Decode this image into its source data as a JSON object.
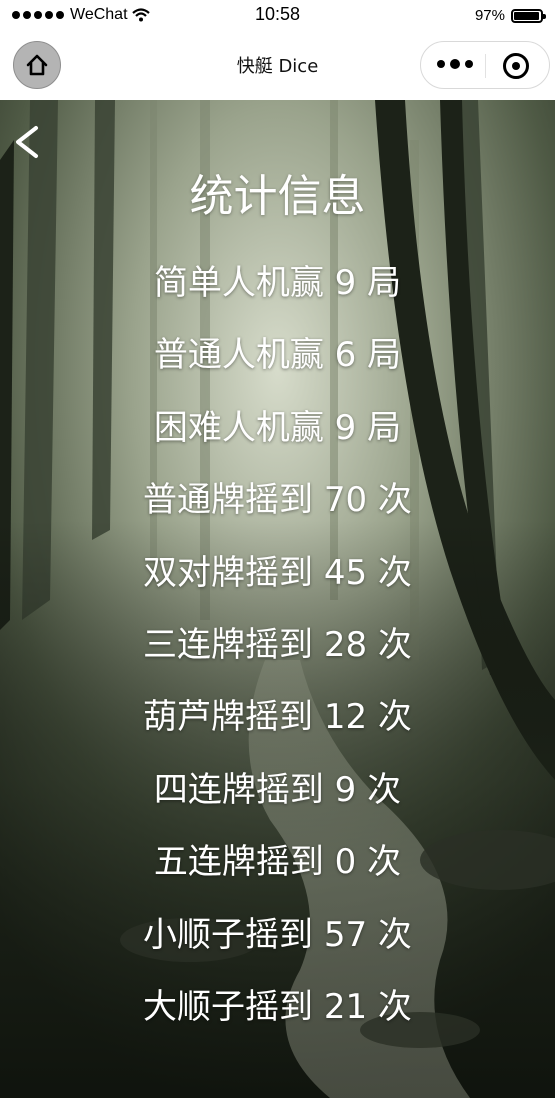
{
  "status_bar": {
    "carrier": "WeChat",
    "time": "10:58",
    "battery_percent_label": "97%",
    "battery_level": 0.97
  },
  "nav_bar": {
    "title": "快艇 Dice",
    "home_icon": "home-icon",
    "more_icon": "more-dots-icon",
    "close_icon": "close-target-icon"
  },
  "page": {
    "title": "统计信息",
    "back_icon": "chevron-left-icon"
  },
  "stats": [
    {
      "label": "简单人机赢 9 局"
    },
    {
      "label": "普通人机赢 6 局"
    },
    {
      "label": "困难人机赢 9 局"
    },
    {
      "label": "普通牌摇到 70 次"
    },
    {
      "label": "双对牌摇到 45 次"
    },
    {
      "label": "三连牌摇到 28 次"
    },
    {
      "label": "葫芦牌摇到 12 次"
    },
    {
      "label": "四连牌摇到 9 次"
    },
    {
      "label": "五连牌摇到 0 次"
    },
    {
      "label": "小顺子摇到 57 次"
    },
    {
      "label": "大顺子摇到 21 次"
    }
  ],
  "colors": {
    "text": "#ffffff",
    "home_button_bg": "#b4b4b4",
    "forest_light": "#c9cfbc",
    "forest_dark": "#1e2419"
  }
}
